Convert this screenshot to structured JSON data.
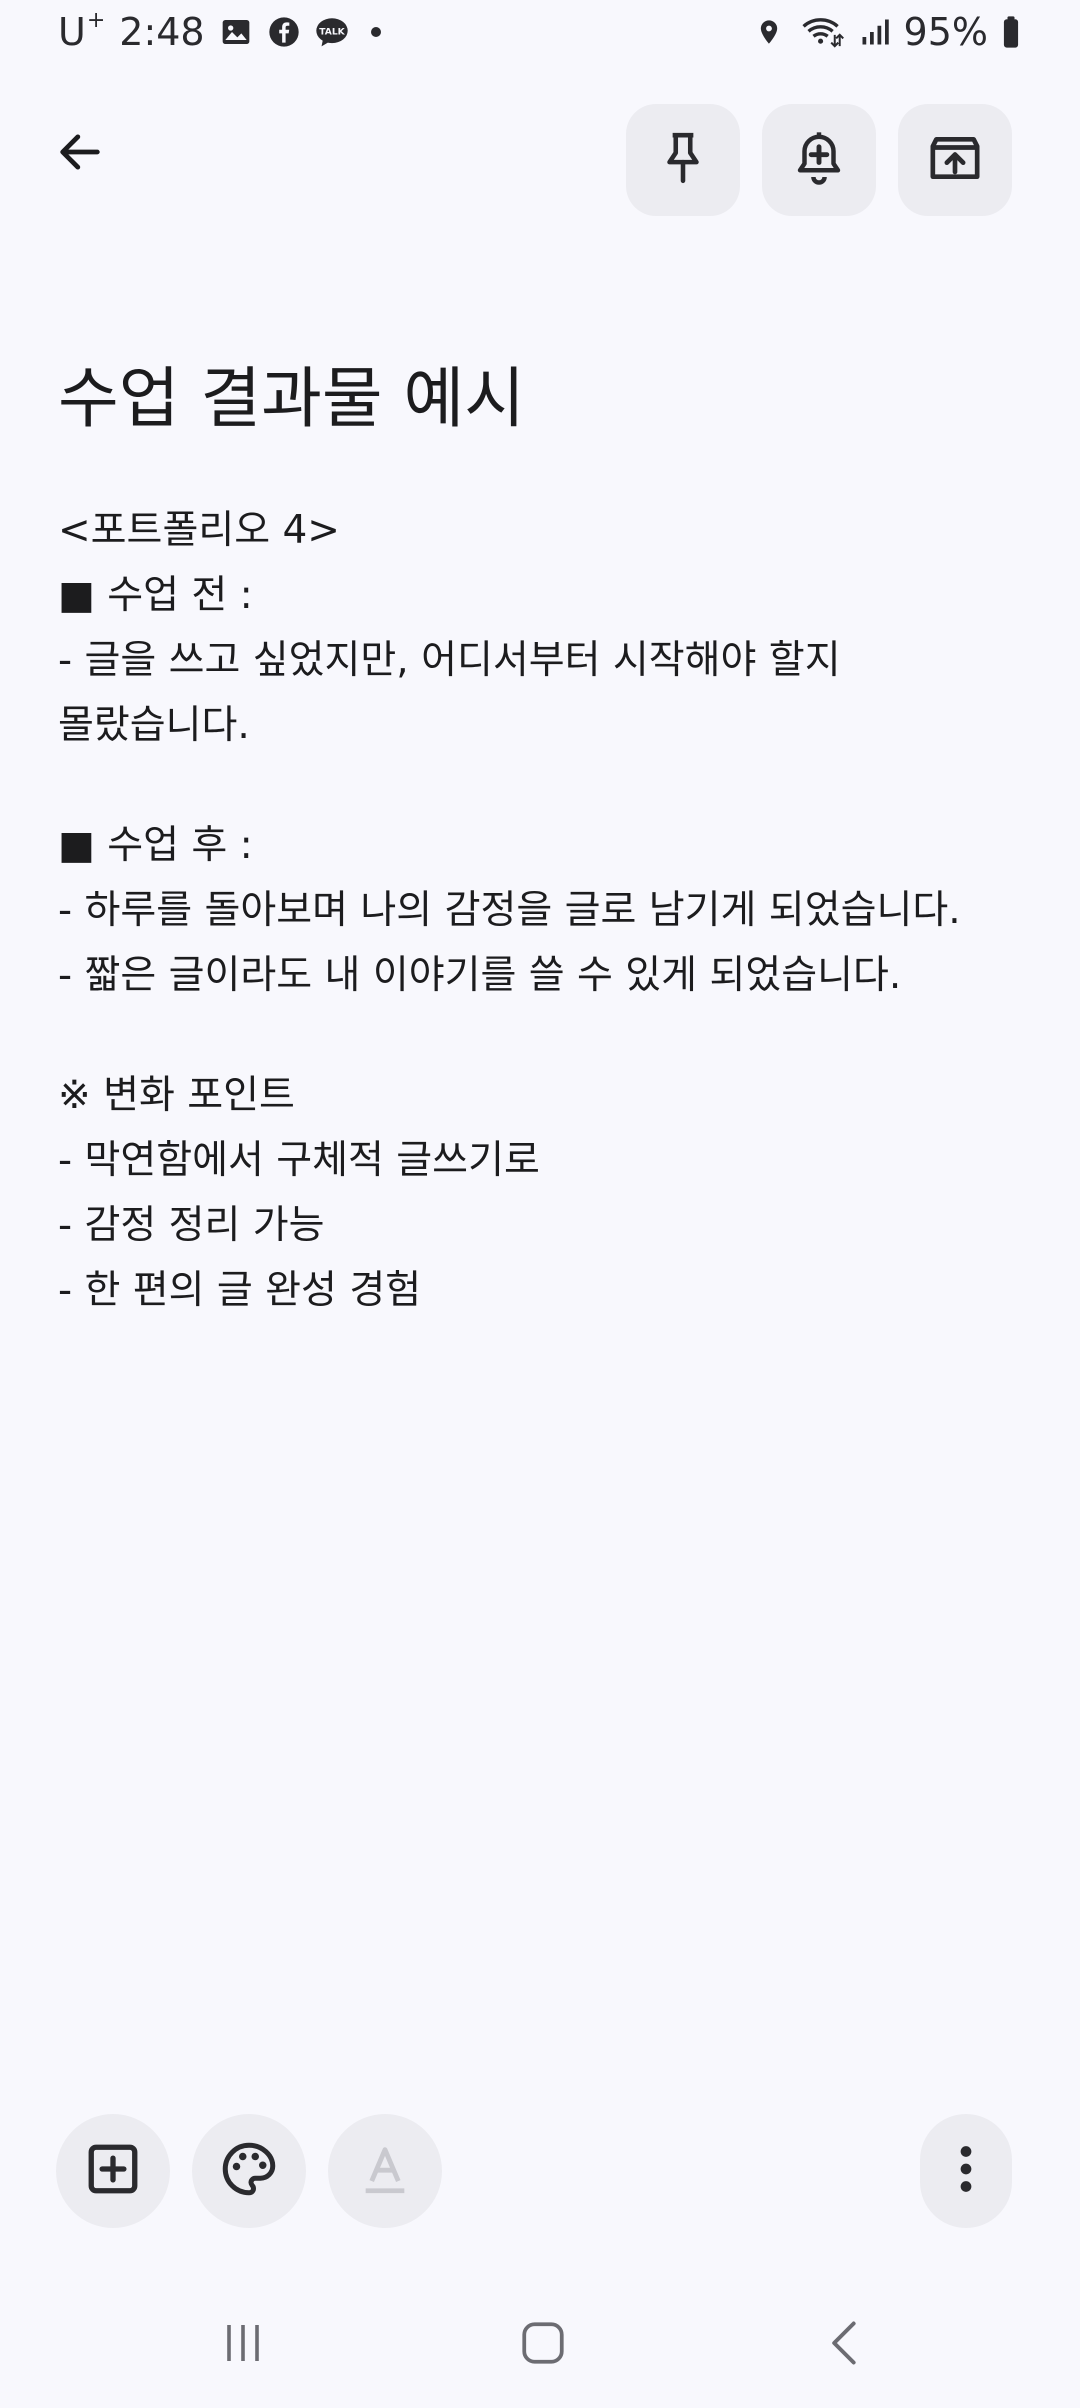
{
  "status_bar": {
    "carrier": "U",
    "carrier_sup": "+",
    "time": "2:48",
    "battery": "95%",
    "notification_icons": [
      "gallery-icon",
      "facebook-icon",
      "kakaotalk-icon"
    ],
    "system_icons": [
      "location-icon",
      "wifi-icon",
      "signal-icon",
      "battery-icon"
    ]
  },
  "toolbar": {
    "back": "back-arrow-icon",
    "actions": [
      "pin-icon",
      "reminder-icon",
      "archive-icon"
    ]
  },
  "note": {
    "title": "수업 결과물 예시",
    "lines": [
      "<포트폴리오 4>",
      "■ 수업 전 :",
      "- 글을 쓰고 싶었지만, 어디서부터 시작해야 할지",
      "몰랐습니다.",
      "",
      "■ 수업 후 :",
      "- 하루를 돌아보며 나의 감정을 글로 남기게 되었습니다.",
      "- 짧은 글이라도 내 이야기를 쓸 수 있게 되었습니다.",
      "",
      "※ 변화 포인트",
      "- 막연함에서 구체적 글쓰기로",
      "- 감정 정리 가능",
      "- 한 편의 글 완성 경험"
    ]
  },
  "bottom_toolbar": {
    "buttons": [
      "add-box-icon",
      "palette-icon",
      "text-format-icon",
      "more-vert-icon"
    ],
    "text_format_enabled": false
  },
  "nav_bar": {
    "buttons": [
      "recent-apps-icon",
      "home-icon",
      "back-icon"
    ]
  },
  "colors": {
    "background": "#f8f8fd",
    "button_bg": "#ececf1",
    "text": "#1c1c1e",
    "disabled": "#c9c9cf"
  }
}
